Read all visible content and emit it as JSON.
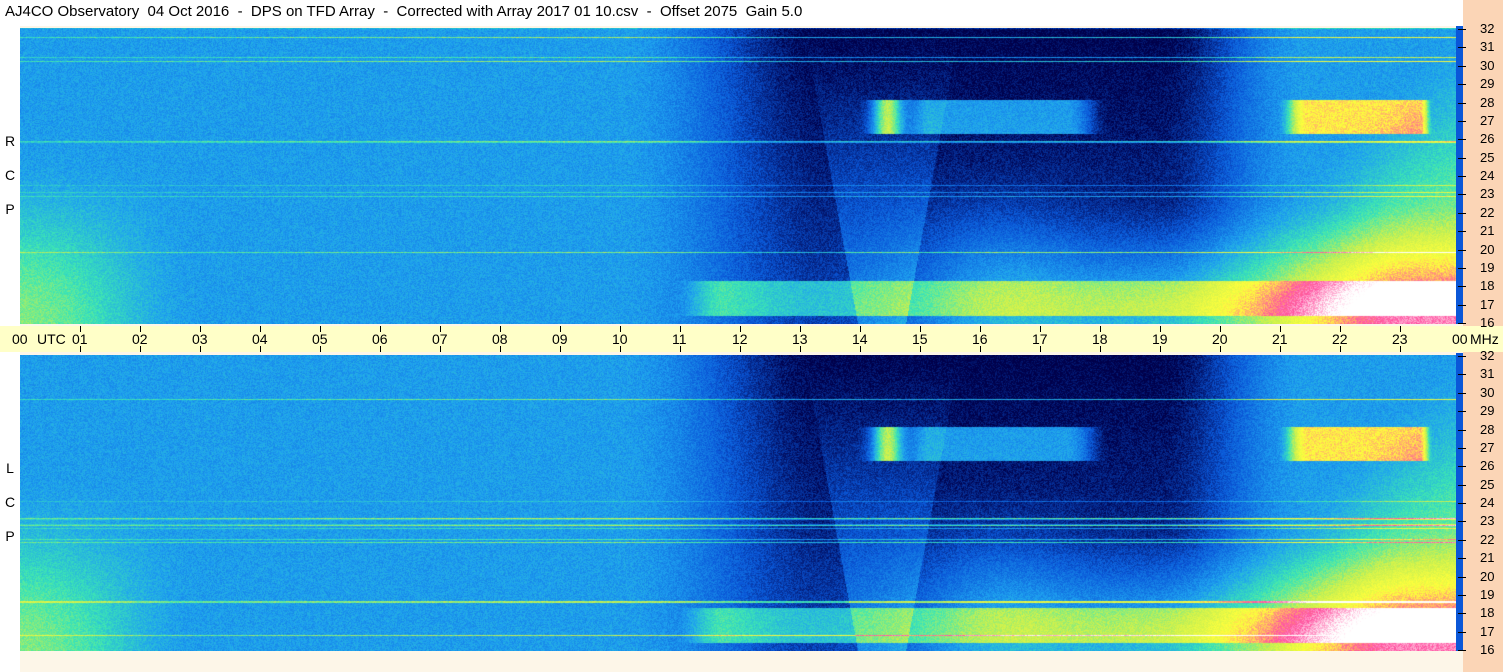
{
  "title": "AJ4CO Observatory  04 Oct 2016  -  DPS on TFD Array  -  Corrected with Array 2017 01 10.csv  -  Offset 2075  Gain 5.0",
  "panels": [
    {
      "id": "rcp",
      "label_letters": [
        "R",
        "C",
        "P"
      ]
    },
    {
      "id": "lcp",
      "label_letters": [
        "L",
        "C",
        "P"
      ]
    }
  ],
  "time_axis": {
    "first_label": "00",
    "utc_label": "UTC",
    "hour_labels": [
      "01",
      "02",
      "03",
      "04",
      "05",
      "06",
      "07",
      "08",
      "09",
      "10",
      "11",
      "12",
      "13",
      "14",
      "15",
      "16",
      "17",
      "18",
      "19",
      "20",
      "21",
      "22",
      "23"
    ],
    "last_label": "00",
    "unit_label": "MHz"
  },
  "freq_labels": [
    "32",
    "31",
    "30",
    "29",
    "28",
    "27",
    "26",
    "25",
    "24",
    "23",
    "22",
    "21",
    "20",
    "19",
    "18",
    "17",
    "16"
  ],
  "chart_data": {
    "type": "heatmap",
    "title": "AJ4CO Observatory  04 Oct 2016  -  DPS on TFD Array  -  Corrected with Array 2017 01 10.csv  -  Offset 2075  Gain 5.0",
    "xlabel": "UTC",
    "ylabel": "MHz",
    "x_range_hours": [
      0,
      24
    ],
    "y_range_mhz": [
      16,
      32
    ],
    "series": [
      {
        "name": "RCP"
      },
      {
        "name": "LCP"
      }
    ],
    "colormap": [
      "#00004a",
      "#0a57d8",
      "#1ea0f0",
      "#3ce6b4",
      "#c8f050",
      "#ffff3c",
      "#ff50a0",
      "#ffffff"
    ]
  },
  "colors": {
    "background": "#fdf6e8",
    "axis_strip": "#ffffc8",
    "freq_strip": "#fbd5b6",
    "base_blue": "#0a57d8"
  }
}
